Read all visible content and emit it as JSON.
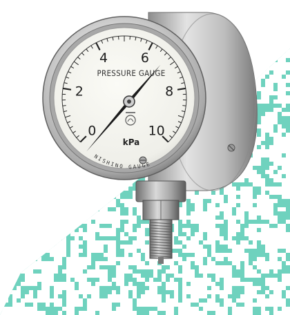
{
  "gauge": {
    "title": "PRESSURE GAUGE",
    "unit": "kPa",
    "brand": "NISHINO GAUGE",
    "scale_labels": [
      "0",
      "2",
      "4",
      "6",
      "8",
      "10"
    ],
    "range_min": 0,
    "range_max": 10,
    "reading": 6.5
  },
  "colors": {
    "background": "#ffffff",
    "pattern": "#6fd2be",
    "dial_face": "#f4f4ef",
    "needle": "#1b1b1b"
  }
}
